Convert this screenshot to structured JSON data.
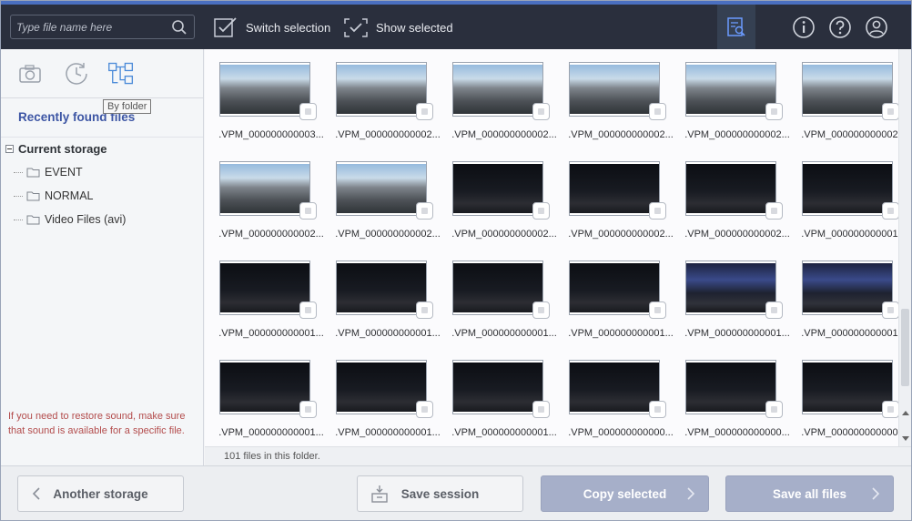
{
  "topbar": {
    "search_placeholder": "Type file name here",
    "switch_label": "Switch selection",
    "show_label": "Show selected"
  },
  "left": {
    "tooltip": "By folder",
    "recent_label": "Recently found files",
    "tree_root": "Current storage",
    "folders": [
      "EVENT",
      "NORMAL",
      "Video Files (avi)"
    ],
    "hint": "If you need to restore sound, make sure that sound is available for a specific file."
  },
  "files": [
    ".VPM_000000000003...",
    ".VPM_000000000002...",
    ".VPM_000000000002...",
    ".VPM_000000000002...",
    ".VPM_000000000002...",
    ".VPM_000000000002...",
    ".VPM_000000000002...",
    ".VPM_000000000002...",
    ".VPM_000000000002...",
    ".VPM_000000000002...",
    ".VPM_000000000002...",
    ".VPM_000000000001...",
    ".VPM_000000000001...",
    ".VPM_000000000001...",
    ".VPM_000000000001...",
    ".VPM_000000000001...",
    ".VPM_000000000001...",
    ".VPM_000000000001...",
    ".VPM_000000000001...",
    ".VPM_000000000001...",
    ".VPM_000000000001...",
    ".VPM_000000000000...",
    ".VPM_000000000000...",
    ".VPM_000000000000..."
  ],
  "thumb_styles": [
    "day",
    "day",
    "day",
    "day",
    "day",
    "day",
    "day",
    "day",
    "night",
    "night",
    "night",
    "night",
    "night",
    "night",
    "night",
    "night",
    "city",
    "city",
    "night",
    "night",
    "night",
    "night",
    "night",
    "night"
  ],
  "status": "101 files in this folder.",
  "bottom": {
    "another_label": "Another storage",
    "session_label": "Save session",
    "copy_label": "Copy selected",
    "saveall_label": "Save all files"
  },
  "colors": {
    "topbar": "#2a2f3d",
    "accent": "#3c55a4",
    "primary_button": "#a6afc9"
  }
}
